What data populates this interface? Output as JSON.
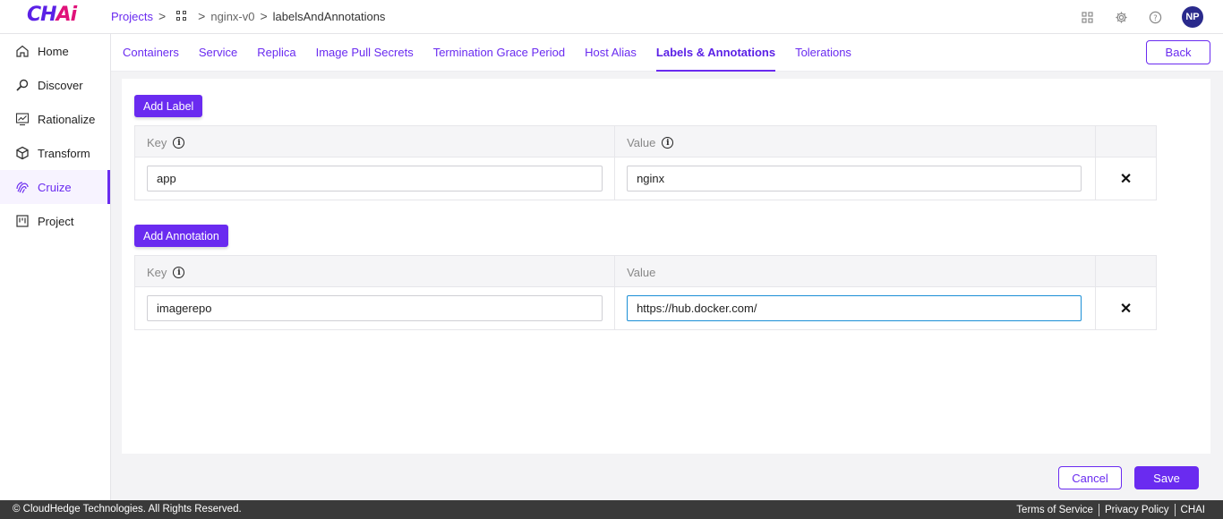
{
  "app": {
    "logo_prefix": "CH",
    "logo_suffix": "Ai"
  },
  "breadcrumb": {
    "projects": "Projects",
    "sep": ">",
    "project": "nginx-v0",
    "page": "labelsAndAnnotations"
  },
  "header": {
    "icons": [
      "grid-icon",
      "settings-icon",
      "help-icon"
    ],
    "avatar_initials": "NP"
  },
  "sidebar": {
    "items": [
      {
        "label": "Home",
        "icon": "home-icon"
      },
      {
        "label": "Discover",
        "icon": "discover-icon"
      },
      {
        "label": "Rationalize",
        "icon": "rationalize-icon"
      },
      {
        "label": "Transform",
        "icon": "transform-icon"
      },
      {
        "label": "Cruize",
        "icon": "cruize-icon",
        "active": true
      },
      {
        "label": "Project",
        "icon": "project-icon"
      }
    ]
  },
  "tabs": [
    {
      "label": "Containers"
    },
    {
      "label": "Service"
    },
    {
      "label": "Replica"
    },
    {
      "label": "Image Pull Secrets"
    },
    {
      "label": "Termination Grace Period"
    },
    {
      "label": "Host Alias"
    },
    {
      "label": "Labels & Annotations",
      "active": true
    },
    {
      "label": "Tolerations"
    }
  ],
  "back_label": "Back",
  "labels": {
    "add_label": "Add Label",
    "key_header": "Key",
    "value_header": "Value",
    "rows": [
      {
        "key": "app",
        "value": "nginx"
      }
    ]
  },
  "annotations": {
    "add_label": "Add Annotation",
    "key_header": "Key",
    "value_header": "Value",
    "rows": [
      {
        "key": "imagerepo",
        "value": "https://hub.docker.com/"
      }
    ]
  },
  "actions": {
    "cancel": "Cancel",
    "save": "Save"
  },
  "footer": {
    "copyright": "© CloudHedge Technologies. All Rights Reserved.",
    "links": [
      "Terms of Service",
      "Privacy Policy",
      "CHAI"
    ]
  },
  "colors": {
    "accent": "#6a2bf0",
    "brand_pink": "#e0127a",
    "focus": "#1b8fd6"
  }
}
